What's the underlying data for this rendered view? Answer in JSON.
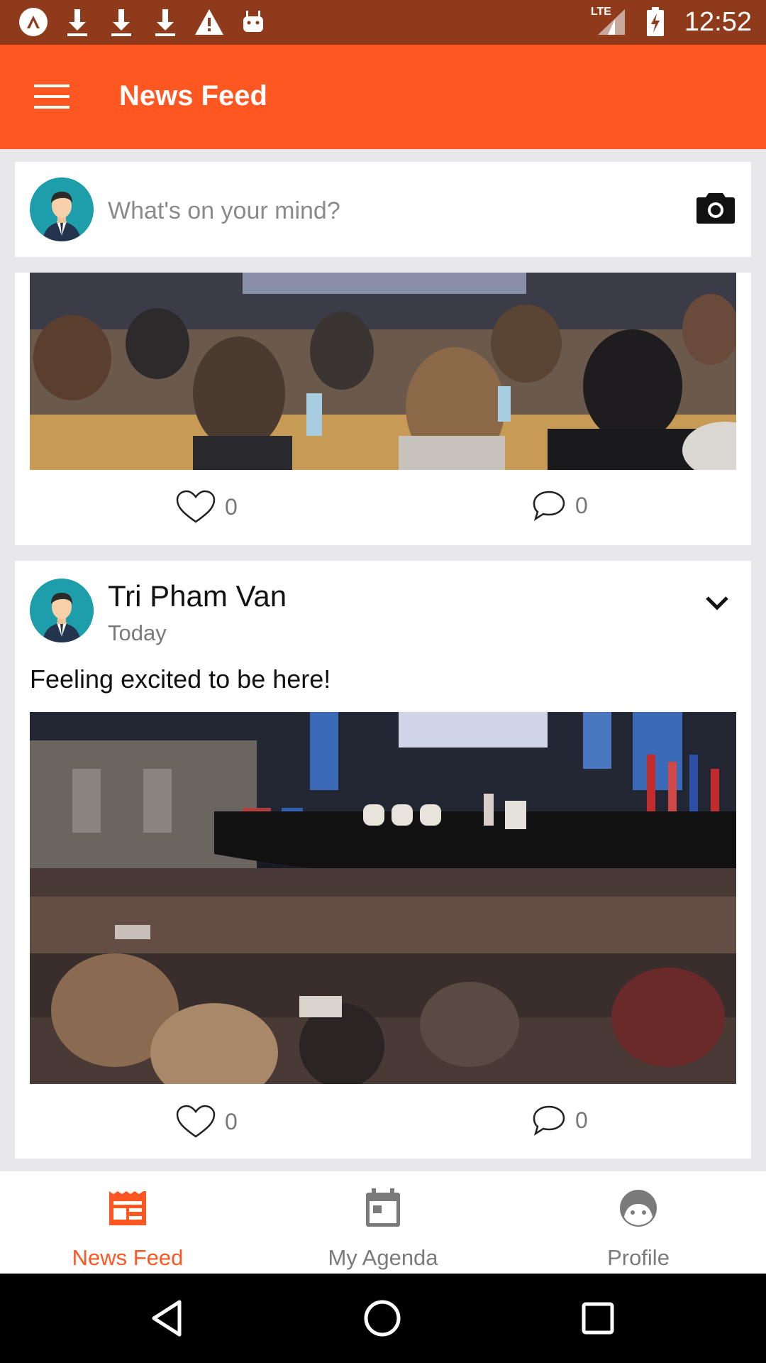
{
  "status_bar": {
    "time": "12:52",
    "network": "LTE",
    "icons": [
      "app-icon",
      "download-icon",
      "download-icon",
      "download-icon",
      "warning-icon",
      "android-icon",
      "signal-icon",
      "battery-charging-icon"
    ]
  },
  "app_bar": {
    "title": "News Feed",
    "menu_icon": "hamburger-menu-icon"
  },
  "composer": {
    "placeholder": "What's on your mind?",
    "camera_icon": "camera-icon"
  },
  "posts": [
    {
      "image": "conference-audience-photo",
      "likes": "0",
      "comments": "0"
    },
    {
      "author": "Tri Pham Van",
      "time": "Today",
      "text": "Feeling excited to be here!",
      "image": "conference-hall-stage-photo",
      "likes": "0",
      "comments": "0"
    }
  ],
  "bottom_nav": {
    "items": [
      {
        "label": "News Feed",
        "icon": "news-feed-icon",
        "active": true
      },
      {
        "label": "My Agenda",
        "icon": "calendar-icon",
        "active": false
      },
      {
        "label": "Profile",
        "icon": "profile-icon",
        "active": false
      }
    ]
  },
  "colors": {
    "accent": "#ff5722",
    "status_bar": "#8f3a1b",
    "background": "#e8e8ec"
  }
}
